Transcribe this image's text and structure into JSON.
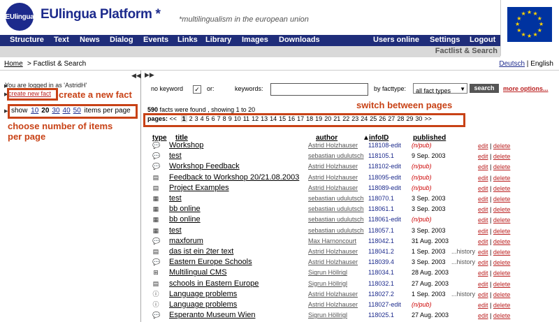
{
  "header": {
    "logo_text": "EUlingua",
    "brand": "EUlingua Platform *",
    "tagline": "*multilingualism in the european union"
  },
  "nav": {
    "left": [
      "Structure",
      "Text",
      "News",
      "Dialog",
      "Events",
      "Links",
      "Library",
      "Images",
      "Downloads"
    ],
    "right": [
      "Users online",
      "Settings",
      "Logout"
    ]
  },
  "section_title": "Factlist & Search",
  "breadcrumb": {
    "home": "Home",
    "rest": " > Factlist & Search"
  },
  "languages": {
    "de": "Deutsch",
    "sep": " | ",
    "en": "English"
  },
  "sidebar": {
    "logged_in": "You are logged in as 'AstridH'",
    "create_link": "create new fact",
    "show_label": "show",
    "counts": [
      "10",
      "20",
      "30",
      "40",
      "50"
    ],
    "selected_count": "20",
    "items_label": "items per page"
  },
  "annotations": {
    "create": "create a new fact",
    "choose_line1": "choose number of items",
    "choose_line2": "per page",
    "switch": "switch between pages"
  },
  "search": {
    "no_keyword": "no keyword",
    "or": "or:",
    "keywords": "keywords:",
    "by_facttype": "by facttype:",
    "facttype_value": "all fact types",
    "button": "search",
    "more": "more options..."
  },
  "results": {
    "found_count": "590",
    "found_text": " facts were found , showing 1 to 20",
    "pages_label": "pages:",
    "prev": "<<",
    "next": ">>",
    "current_page": "1",
    "page_numbers": [
      "1",
      "2",
      "3",
      "4",
      "5",
      "6",
      "7",
      "8",
      "9",
      "10",
      "11",
      "12",
      "13",
      "14",
      "15",
      "16",
      "17",
      "18",
      "19",
      "20",
      "21",
      "22",
      "23",
      "24",
      "25",
      "26",
      "27",
      "28",
      "29",
      "30"
    ]
  },
  "columns": {
    "type": "type",
    "title": "title",
    "author": "author",
    "infoid": "infoID",
    "published": "published"
  },
  "rows": [
    {
      "icon": "speech-icon",
      "title": "Workshop",
      "author": "Astrid Holzhauser",
      "id": "118108-edit",
      "pub": "(n/pub)",
      "hist": ""
    },
    {
      "icon": "speech-icon",
      "title": "test",
      "author": "sebastian udulutsch",
      "id": "118105.1",
      "pub": "9 Sep. 2003",
      "hist": ""
    },
    {
      "icon": "speech-icon",
      "title": "Workshop Feedback",
      "author": "Astrid Holzhauser",
      "id": "118102-edit",
      "pub": "(n/pub)",
      "hist": ""
    },
    {
      "icon": "document-icon",
      "title": "Feedback to Workshop 20/21.08.2003",
      "author": "Astrid Holzhauser",
      "id": "118095-edit",
      "pub": "(n/pub)",
      "hist": ""
    },
    {
      "icon": "document-icon",
      "title": "Project Examples",
      "author": "Astrid Holzhauser",
      "id": "118089-edit",
      "pub": "(n/pub)",
      "hist": ""
    },
    {
      "icon": "calendar-icon",
      "title": "test",
      "author": "sebastian udulutsch",
      "id": "118070.1",
      "pub": "3 Sep. 2003",
      "hist": ""
    },
    {
      "icon": "calendar-icon",
      "title": "bb online",
      "author": "sebastian udulutsch",
      "id": "118061.1",
      "pub": "3 Sep. 2003",
      "hist": ""
    },
    {
      "icon": "calendar-icon",
      "title": "bb online",
      "author": "sebastian udulutsch",
      "id": "118061-edit",
      "pub": "(n/pub)",
      "hist": ""
    },
    {
      "icon": "calendar-icon",
      "title": "test",
      "author": "sebastian udulutsch",
      "id": "118057.1",
      "pub": "3 Sep. 2003",
      "hist": ""
    },
    {
      "icon": "speech-icon",
      "title": "maxforum",
      "author": "Max Harnoncourt",
      "id": "118042.1",
      "pub": "31 Aug. 2003",
      "hist": ""
    },
    {
      "icon": "document-icon",
      "title": "das ist ein 2ter text",
      "author": "Astrid Holzhauser",
      "id": "118041.2",
      "pub": "1 Sep. 2003",
      "hist": "...history"
    },
    {
      "icon": "speech-icon",
      "title": "Eastern Europe Schools",
      "author": "Astrid Holzhauser",
      "id": "118039.4",
      "pub": "3 Sep. 2003",
      "hist": "...history"
    },
    {
      "icon": "grid-icon",
      "title": "Multilingual CMS",
      "author": "Sigrun Höllrigl",
      "id": "118034.1",
      "pub": "28 Aug. 2003",
      "hist": ""
    },
    {
      "icon": "document-icon",
      "title": "schools in Eastern Europe",
      "author": "Sigrun Höllrigl",
      "id": "118032.1",
      "pub": "27 Aug. 2003",
      "hist": ""
    },
    {
      "icon": "info-icon",
      "title": "Language problems",
      "author": "Astrid Holzhauser",
      "id": "118027.2",
      "pub": "1 Sep. 2003",
      "hist": "...history"
    },
    {
      "icon": "info-icon",
      "title": "Language problems",
      "author": "Astrid Holzhauser",
      "id": "118027-edit",
      "pub": "(n/pub)",
      "hist": ""
    },
    {
      "icon": "speech-icon",
      "title": "Esperanto Museum Wien",
      "author": "Sigrun Höllrigl",
      "id": "118025.1",
      "pub": "27 Aug. 2003",
      "hist": ""
    }
  ],
  "row_actions": {
    "edit": "edit",
    "sep": " | ",
    "delete": "delete"
  },
  "colors": {
    "brand_blue": "#1c2a8c",
    "nav_bg": "#1f2d7a",
    "annotation": "#c84216",
    "link_red": "#b22222"
  }
}
